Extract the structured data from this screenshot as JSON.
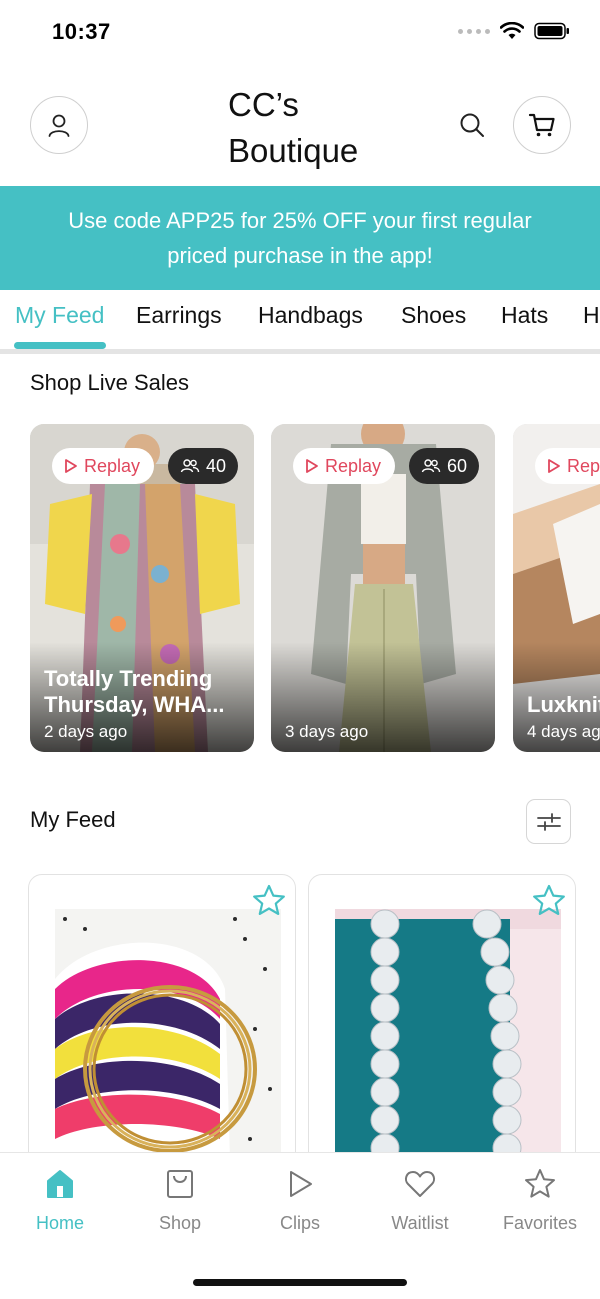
{
  "status": {
    "time": "10:37"
  },
  "header": {
    "brand_line1": "CC’s",
    "brand_line2": "Boutique"
  },
  "promo": {
    "text": "Use code APP25 for 25% OFF your first regular priced purchase in the app!"
  },
  "tabs": [
    {
      "label": "My Feed",
      "active": true
    },
    {
      "label": "Earrings",
      "active": false
    },
    {
      "label": "Handbags",
      "active": false
    },
    {
      "label": "Shoes",
      "active": false
    },
    {
      "label": "Hats",
      "active": false
    },
    {
      "label": "H",
      "active": false
    }
  ],
  "live_sales": {
    "title": "Shop Live Sales",
    "cards": [
      {
        "replay_label": "Replay",
        "viewers": "40",
        "title": "Totally Trending Thursday, WHA...",
        "ago": "2 days ago"
      },
      {
        "replay_label": "Replay",
        "viewers": "60",
        "title": "",
        "ago": "3 days ago"
      },
      {
        "replay_label": "Rep",
        "viewers": "",
        "title": "Luxknit Umgee",
        "ago": "4 days ag"
      }
    ]
  },
  "feed": {
    "title": "My Feed"
  },
  "bottom_nav": [
    {
      "label": "Home",
      "icon": "home-icon",
      "active": true
    },
    {
      "label": "Shop",
      "icon": "shopping-bag-icon",
      "active": false
    },
    {
      "label": "Clips",
      "icon": "play-icon",
      "active": false
    },
    {
      "label": "Waitlist",
      "icon": "heart-icon",
      "active": false
    },
    {
      "label": "Favorites",
      "icon": "star-icon",
      "active": false
    }
  ],
  "colors": {
    "accent": "#45c0c4",
    "replay": "#e0475d"
  }
}
